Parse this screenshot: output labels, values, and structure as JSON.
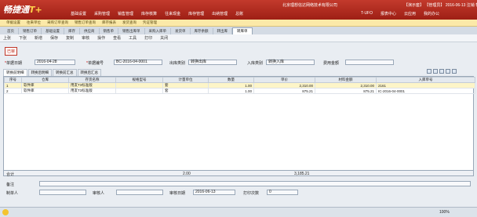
{
  "app": {
    "logo_main": "畅捷通",
    "logo_accent": "T+",
    "company": "北京理想信达网络技术有限公司"
  },
  "header": {
    "user_links": [
      "【演示套】",
      "【管理员】",
      "2016-06-13",
      "注销",
      "帮助"
    ],
    "main_nav": [
      "基础设置",
      "采购管理",
      "销售管理",
      "库存核算",
      "往来现金",
      "库存管理",
      "出纳管理",
      "总账",
      "报表中心",
      "云应用",
      "我的办公"
    ],
    "right_nav": [
      "T-UFO",
      "报表中心",
      "云应用",
      "我的办公"
    ]
  },
  "bookmarks": [
    "单据设置",
    "往来单位",
    "采购订单查询",
    "销售订单查询",
    "库存报表",
    "发货查询",
    "凭证管理"
  ],
  "tabs": [
    "首页",
    "销售订单",
    "基础设置",
    "库存",
    "供应商",
    "销售单",
    "销售出库单",
    "采购入库单",
    "发货单",
    "库存余额",
    "转出库",
    "转库单"
  ],
  "active_tab": "转库单",
  "toolbar": [
    "上张",
    "下张",
    "新增",
    "保存",
    "复制",
    "审核",
    "操作",
    "查看",
    "工具",
    "打印",
    "关闭"
  ],
  "badge": "已审",
  "form": {
    "date_label": "单据日期",
    "date_value": "2016-04-28",
    "code_label": "单据编号",
    "code_value": "BC-2016-04-0001",
    "out_type_label": "出库类别",
    "out_type_value": "转换出库",
    "in_type_label": "入库类别",
    "in_type_value": "转换入库",
    "cost_label": "费用金额"
  },
  "subtabs": [
    "转换前明细",
    "转换后明细",
    "转换前汇总",
    "转换后汇总"
  ],
  "grid": {
    "columns": [
      "序号",
      "仓库",
      "存货名称",
      "规格型号",
      "计量单位",
      "数量",
      "单价",
      "材料金额",
      "入库单号"
    ],
    "rows": [
      [
        "1",
        "软件库",
        "用友T3标准版",
        "",
        "套",
        "1.00",
        "2,310.00",
        "2,310.00",
        "2161"
      ],
      [
        "2",
        "软件库",
        "用友T3标准版",
        "",
        "套",
        "1.00",
        "875.21",
        "875.21",
        "IC-2016-04-0001"
      ]
    ]
  },
  "totals": {
    "label": "合计",
    "qty": "2.00",
    "amount": "3,185.21"
  },
  "footer": {
    "remark_label": "备注",
    "maker_label": "制单人",
    "reviewer_label": "审核人",
    "review_date_label": "审核日期",
    "review_date_value": "2016-06-13",
    "print_label": "打印次数",
    "print_value": "0"
  },
  "status": {
    "zoom": "100%"
  }
}
